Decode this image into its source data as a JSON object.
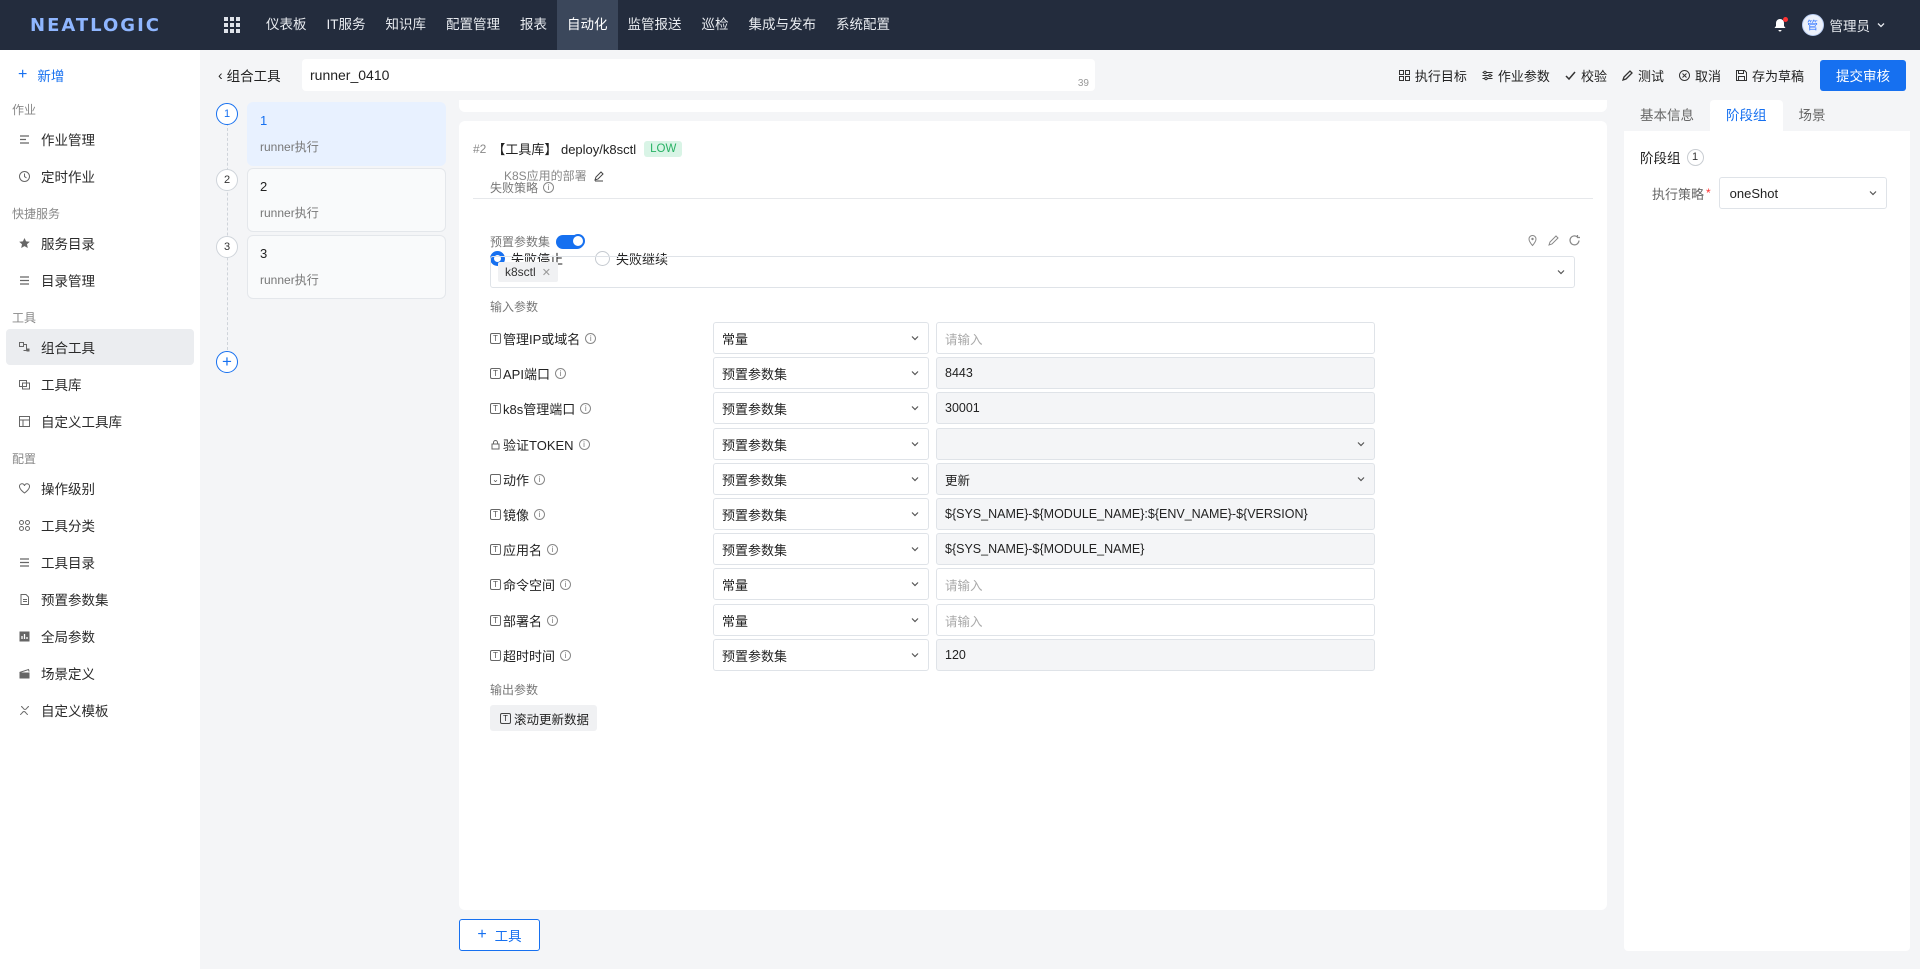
{
  "app": {
    "logo": "NEATLOGIC"
  },
  "topnav": {
    "items": [
      "仪表板",
      "IT服务",
      "知识库",
      "配置管理",
      "报表",
      "自动化",
      "监管报送",
      "巡检",
      "集成与发布",
      "系统配置"
    ],
    "active_index": 5,
    "user_avatar": "管",
    "user_name": "管理员"
  },
  "sidebar": {
    "add_label": "新增",
    "groups": [
      {
        "label": "作业",
        "items": [
          {
            "label": "作业管理",
            "icon": "job-manage-icon"
          },
          {
            "label": "定时作业",
            "icon": "clock-icon"
          }
        ]
      },
      {
        "label": "快捷服务",
        "items": [
          {
            "label": "服务目录",
            "icon": "star-icon"
          },
          {
            "label": "目录管理",
            "icon": "list-icon"
          }
        ]
      },
      {
        "label": "工具",
        "items": [
          {
            "label": "组合工具",
            "icon": "combine-tool-icon",
            "active": true
          },
          {
            "label": "工具库",
            "icon": "tool-lib-icon"
          },
          {
            "label": "自定义工具库",
            "icon": "custom-tool-icon"
          }
        ]
      },
      {
        "label": "配置",
        "items": [
          {
            "label": "操作级别",
            "icon": "level-icon"
          },
          {
            "label": "工具分类",
            "icon": "category-icon"
          },
          {
            "label": "工具目录",
            "icon": "list-icon"
          },
          {
            "label": "预置参数集",
            "icon": "doc-icon"
          },
          {
            "label": "全局参数",
            "icon": "chart-icon"
          },
          {
            "label": "场景定义",
            "icon": "scene-icon"
          },
          {
            "label": "自定义模板",
            "icon": "template-icon"
          }
        ]
      }
    ]
  },
  "header": {
    "back_label": "组合工具",
    "name_value": "runner_0410",
    "name_count": "39",
    "actions": [
      {
        "label": "执行目标",
        "icon": "target-icon"
      },
      {
        "label": "作业参数",
        "icon": "params-icon"
      },
      {
        "label": "校验",
        "icon": "check-icon"
      },
      {
        "label": "测试",
        "icon": "test-icon"
      },
      {
        "label": "取消",
        "icon": "cancel-icon"
      },
      {
        "label": "存为草稿",
        "icon": "save-icon"
      }
    ],
    "submit_label": "提交审核"
  },
  "steps": [
    {
      "num": "1",
      "title": "1",
      "sub": "runner执行",
      "active": true
    },
    {
      "num": "2",
      "title": "2",
      "sub": "runner执行"
    },
    {
      "num": "3",
      "title": "3",
      "sub": "runner执行"
    }
  ],
  "tool": {
    "index": "#2",
    "name": "【工具库】 deploy/k8sctl",
    "risk": "LOW",
    "desc": "K8S应用的部署",
    "fail_label": "失败策略",
    "fail_options": [
      "失败停止",
      "失败继续"
    ],
    "preset_label": "预置参数集",
    "preset_chip": "k8sctl",
    "input_label": "输入参数",
    "output_label": "输出参数",
    "refresh_label": "滚动更新数据",
    "params": [
      {
        "label": "管理IP或域名",
        "icon": "text-icon",
        "type": "常量",
        "value": "",
        "placeholder": "请输入",
        "kind": "input"
      },
      {
        "label": "API端口",
        "icon": "text-icon",
        "type": "预置参数集",
        "value": "8443",
        "kind": "ro"
      },
      {
        "label": "k8s管理端口",
        "icon": "text-icon",
        "type": "预置参数集",
        "value": "30001",
        "kind": "ro"
      },
      {
        "label": "验证TOKEN",
        "icon": "lock-icon",
        "type": "预置参数集",
        "value": "",
        "kind": "ro-select"
      },
      {
        "label": "动作",
        "icon": "select-icon",
        "type": "预置参数集",
        "value": "更新",
        "kind": "ro-select"
      },
      {
        "label": "镜像",
        "icon": "text-icon",
        "type": "预置参数集",
        "value": "${SYS_NAME}-${MODULE_NAME}:${ENV_NAME}-${VERSION}",
        "kind": "ro"
      },
      {
        "label": "应用名",
        "icon": "text-icon",
        "type": "预置参数集",
        "value": "${SYS_NAME}-${MODULE_NAME}",
        "kind": "ro"
      },
      {
        "label": "命令空间",
        "icon": "text-icon",
        "type": "常量",
        "value": "",
        "placeholder": "请输入",
        "kind": "input"
      },
      {
        "label": "部署名",
        "icon": "text-icon",
        "type": "常量",
        "value": "",
        "placeholder": "请输入",
        "kind": "input"
      },
      {
        "label": "超时时间",
        "icon": "text-icon",
        "type": "预置参数集",
        "value": "120",
        "kind": "ro"
      }
    ]
  },
  "add_tool_label": "工具",
  "right_panel": {
    "tabs": [
      "基本信息",
      "阶段组",
      "场景"
    ],
    "active_tab": 1,
    "stage_label": "阶段组",
    "stage_count": "1",
    "strategy_label": "执行策略",
    "strategy_value": "oneShot"
  },
  "colors": {
    "primary": "#1670f0",
    "topbar": "#232c3d",
    "risk_low": "#28b264"
  }
}
